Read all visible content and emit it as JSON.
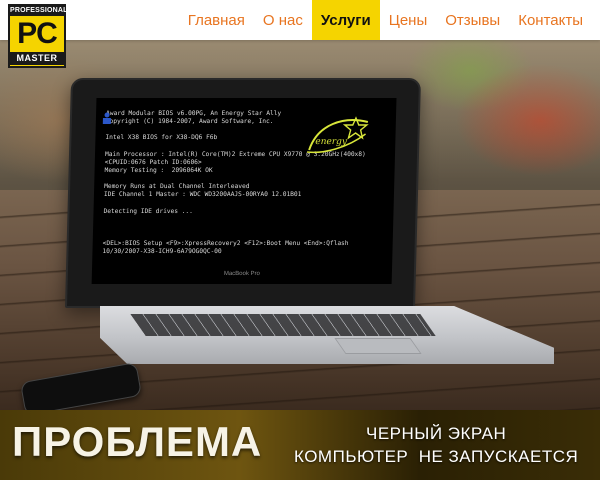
{
  "brand": {
    "logo_top": "PROFESSIONAL",
    "logo_mid": "PC",
    "logo_bottom": "MASTER"
  },
  "nav": {
    "items": [
      {
        "label": "Главная"
      },
      {
        "label": "О нас"
      },
      {
        "label": "Услуги",
        "active": true
      },
      {
        "label": "Цены"
      },
      {
        "label": "Отзывы"
      },
      {
        "label": "Контакты"
      }
    ]
  },
  "bios": {
    "lines": [
      "Award Modular BIOS v6.00PG, An Energy Star Ally",
      "Copyright (C) 1984-2007, Award Software, Inc.",
      "",
      "Intel X38 BIOS for X38-DQ6 F6b",
      "",
      "Main Processor : Intel(R) Core(TM)2 Extreme CPU X9770 @ 3.20GHz(400x8)",
      "<CPUID:0676 Patch ID:0606>",
      "Memory Testing :  2096064K OK",
      "",
      "Memory Runs at Dual Channel Interleaved",
      "IDE Channel 1 Master : WDC WD3200AAJS-00RYA0 12.01B01",
      "",
      "Detecting IDE drives ...",
      "",
      "",
      "",
      "<DEL>:BIOS Setup <F9>:XpressRecovery2 <F12>:Boot Menu <End>:Qflash",
      "10/30/2007-X38-ICH9-6A79OG0QC-00"
    ],
    "energy_logo_text": "energy",
    "laptop_label": "MacBook Pro"
  },
  "banner": {
    "title": "ПРОБЛЕМА",
    "subtitle_1": "ЧЕРНЫЙ ЭКРАН",
    "subtitle_2": "КОМПЬЮТЕР  НЕ ЗАПУСКАЕТСЯ"
  },
  "colors": {
    "accent_yellow": "#f5d400",
    "nav_text": "#e87521",
    "header_bg": "#ffffff"
  }
}
